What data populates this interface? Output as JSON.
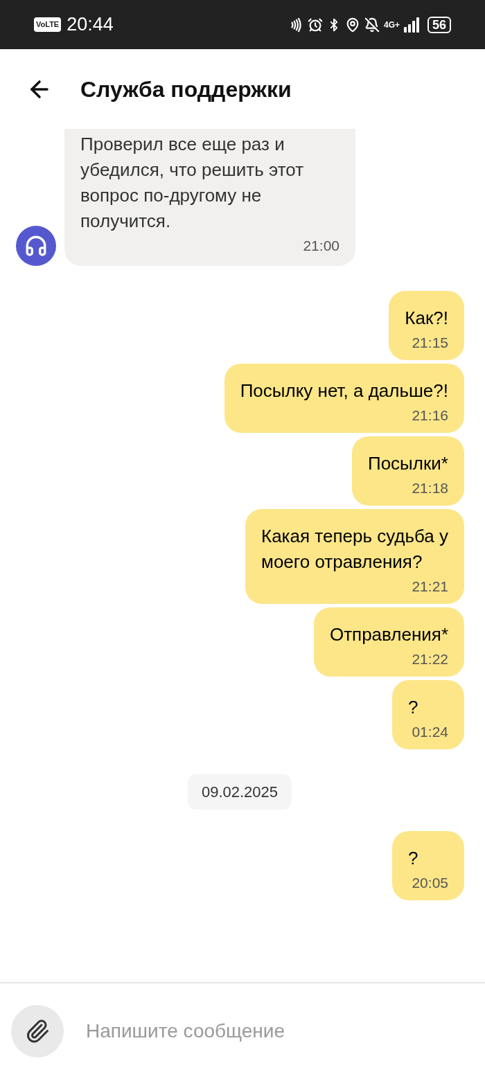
{
  "status_bar": {
    "volte": "VoLTE",
    "time": "20:44",
    "network": "4G+",
    "battery": "56"
  },
  "header": {
    "title": "Служба поддержки"
  },
  "messages": [
    {
      "kind": "incoming",
      "lines": [
        "Проверил все еще раз и",
        "убедился, что решить этот",
        "вопрос по-другому не",
        "получится."
      ],
      "time": "21:00"
    },
    {
      "kind": "outgoing",
      "lines": [
        "Как?!"
      ],
      "time": "21:15"
    },
    {
      "kind": "outgoing",
      "lines": [
        "Посылку нет, а дальше?!"
      ],
      "time": "21:16"
    },
    {
      "kind": "outgoing",
      "lines": [
        "Посылки*"
      ],
      "time": "21:18"
    },
    {
      "kind": "outgoing",
      "lines": [
        "Какая теперь судьба у",
        "моего отравления?"
      ],
      "time": "21:21"
    },
    {
      "kind": "outgoing",
      "lines": [
        "Отправления*"
      ],
      "time": "21:22"
    },
    {
      "kind": "outgoing",
      "lines": [
        "?"
      ],
      "time": "01:24"
    },
    {
      "kind": "date",
      "text": "09.02.2025"
    },
    {
      "kind": "outgoing",
      "lines": [
        "?"
      ],
      "time": "20:05"
    }
  ],
  "composer": {
    "placeholder": "Напишите сообщение"
  }
}
